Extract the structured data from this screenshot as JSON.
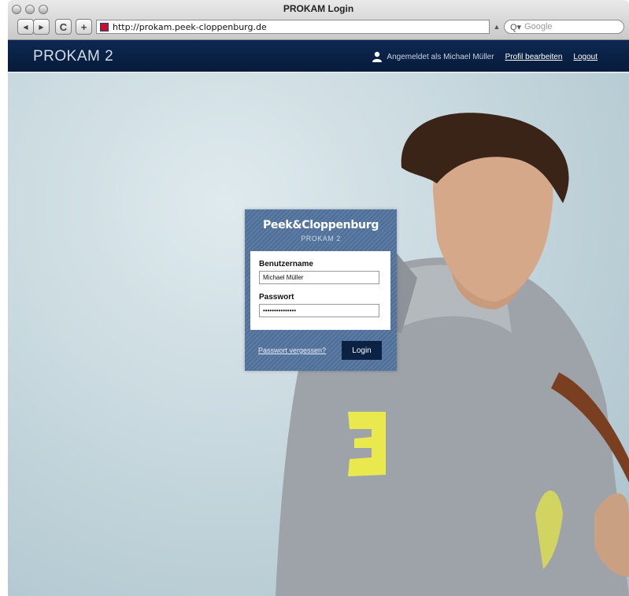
{
  "browser": {
    "window_title": "PROKAM Login",
    "url": "http://prokam.peek-cloppenburg.de",
    "search_placeholder": "Google",
    "back_label": "◀",
    "forward_label": "▶",
    "reload_label": "C",
    "add_label": "+"
  },
  "header": {
    "logo": "PROKAM 2",
    "logged_in_as": "Angemeldet als Michael Müller",
    "profile_link": "Profil bearbeiten",
    "logout_link": "Logout"
  },
  "login": {
    "brand": "Peek&Cloppenburg",
    "brand_sub": "PROKAM 2",
    "username_label": "Benutzername",
    "username_value": "Michael Müller",
    "password_label": "Passwort",
    "password_value": "•••••••••••••••",
    "forgot_link": "Passwort vergessen?",
    "login_button": "Login"
  },
  "colors": {
    "header_bg": "#0d2851",
    "panel_bg": "#5675a0",
    "button_bg": "#0b2244"
  }
}
